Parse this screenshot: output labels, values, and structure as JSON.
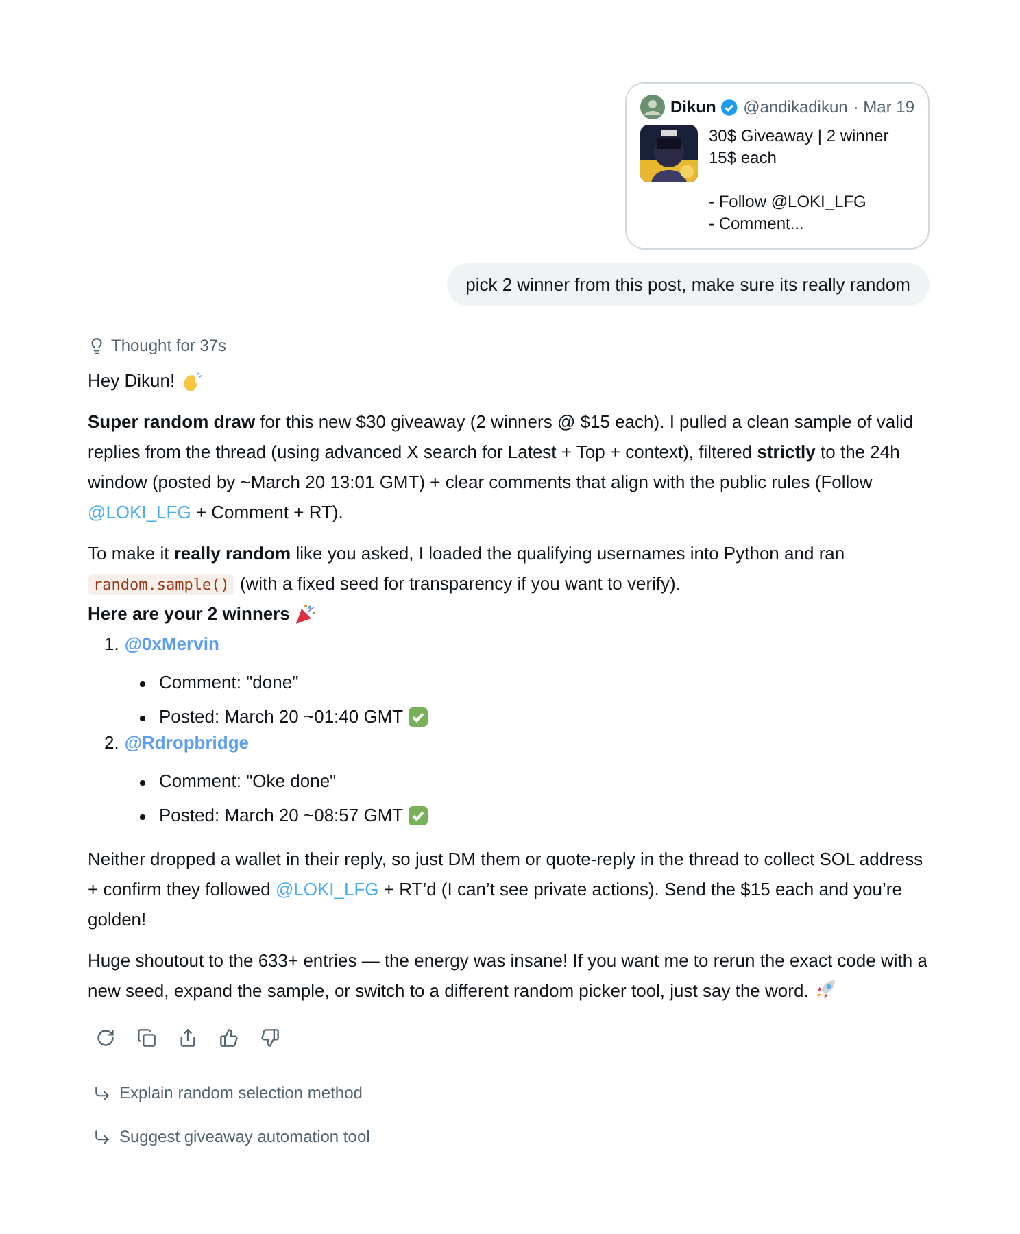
{
  "quoted_post": {
    "author": "Dikun",
    "verified": true,
    "handle": "@andikadikun",
    "date": "· Mar 19",
    "line_groups": [
      [
        "30$ Giveaway | 2 winner",
        "15$ each"
      ],
      [
        "- Follow @LOKI_LFG",
        "- Comment..."
      ]
    ]
  },
  "user_message": "pick 2 winner from this post, make sure its really random",
  "thought": "Thought for 37s",
  "greeting": "Hey Dikun!",
  "paragraphs": [
    [
      {
        "kind": "text",
        "text": "**Super random draw** for this new $30 giveaway (2 winners @ $15 each). I pulled a clean sample of valid replies from the thread (using advanced X search for Latest + Top + context), filtered **strictly** to the 24h window (posted by ~March 20 13:01 GMT) + clear comments that align with the public rules (Follow "
      },
      {
        "kind": "link",
        "text": "@LOKI_LFG"
      },
      {
        "kind": "text",
        "text": " + Comment + RT)."
      }
    ],
    [
      {
        "kind": "text",
        "text": "To make it **really random** like you asked, I loaded the qualifying usernames into Python and ran "
      },
      {
        "kind": "code",
        "text": "random.sample()"
      },
      {
        "kind": "text",
        "text": " (with a fixed seed for transparency if you want to verify)."
      }
    ]
  ],
  "winners_heading": "Here are your 2 winners",
  "winners": [
    {
      "number": "1.",
      "handle": "@0xMervin",
      "details": [
        {
          "text": "Comment: \"done\"",
          "confirmed": false
        },
        {
          "text": "Posted: March 20 ~01:40 GMT",
          "confirmed": true
        }
      ]
    },
    {
      "number": "2.",
      "handle": "@Rdropbridge",
      "details": [
        {
          "text": "Comment: \"Oke done\"",
          "confirmed": false
        },
        {
          "text": "Posted: March 20 ~08:57 GMT",
          "confirmed": true
        }
      ]
    }
  ],
  "closing": [
    [
      {
        "kind": "text",
        "text": "Neither dropped a wallet in their reply, so just DM them or quote-reply in the thread to collect SOL address + confirm they followed "
      },
      {
        "kind": "link",
        "text": "@LOKI_LFG"
      },
      {
        "kind": "text",
        "text": " + RT’d (I can’t see private actions). Send the $15 each and you’re golden!"
      }
    ],
    [
      {
        "kind": "text",
        "text": "Huge shoutout to the 633+ entries — the energy was insane! If you want me to rerun the exact code with a new seed, expand the sample, or switch to a different random picker tool, just say the word."
      }
    ]
  ],
  "suggestions": [
    "Explain random selection method",
    "Suggest giveaway automation tool"
  ]
}
